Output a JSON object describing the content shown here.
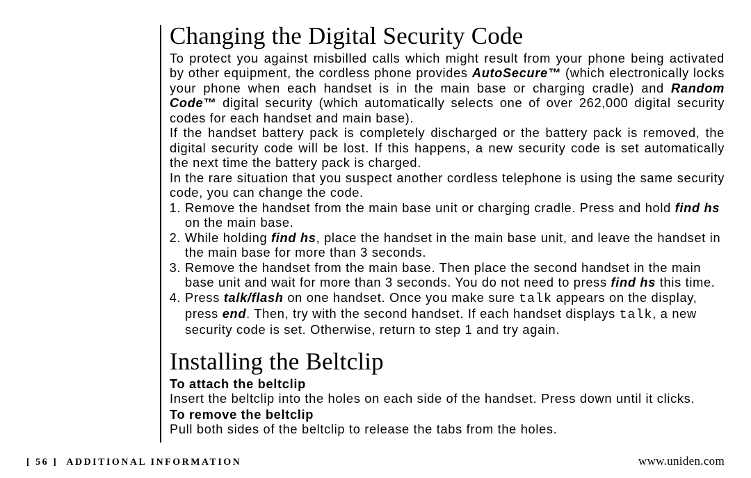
{
  "section1": {
    "heading": "Changing the Digital Security Code",
    "p1a": "To protect you against misbilled calls which might result from your phone being activated by other equipment, the cordless phone provides ",
    "p1_em1": "AutoSecure™",
    "p1b": " (which electronically locks your phone when each handset is in the main base or charging cradle) and ",
    "p1_em2": "Random Code™",
    "p1c": " digital security (which automatically selects one of over 262,000 digital security codes for each handset and main base).",
    "p2": "If the handset battery pack is completely discharged or the battery pack is removed, the digital security code will be lost. If this happens, a new security code is set automatically the next time the battery pack is charged.",
    "p3": "In the rare situation that you suspect another cordless telephone is using the same security code, you can change the code.",
    "step1a": "Remove the handset from the main base unit or charging cradle. Press and hold ",
    "step1_em": "find hs",
    "step1b": " on the main base.",
    "step2a": "While holding ",
    "step2_em": "find hs",
    "step2b": ", place the handset in the main base unit, and leave the handset in the main base for more than 3 seconds.",
    "step3a": "Remove the handset from the main base. Then place the second handset in the main base unit and wait for more than 3 seconds. You do not need to press ",
    "step3_em": "find hs",
    "step3b": " this time.",
    "step4a": "Press ",
    "step4_em1": "talk/flash",
    "step4b": " on one handset. Once you make sure ",
    "step4_mono1": "talk",
    "step4c": " appears on the display, press ",
    "step4_em2": "end",
    "step4d": ". Then, try with the second handset. If each handset displays ",
    "step4_mono2": "talk",
    "step4e": ", a new security code is set. Otherwise, return to step 1 and try again."
  },
  "section2": {
    "heading": "Installing the Beltclip",
    "sub1": "To attach the beltclip",
    "p1": "Insert the beltclip into the holes on each side of the handset. Press down until it clicks.",
    "sub2": "To remove the beltclip",
    "p2": "Pull both sides of the beltclip to release the tabs from the holes."
  },
  "footer": {
    "page_bracket_open": "[ ",
    "page_number": "56",
    "page_bracket_close": " ]",
    "section_label": "ADDITIONAL INFORMATION",
    "url": "www.uniden.com"
  }
}
